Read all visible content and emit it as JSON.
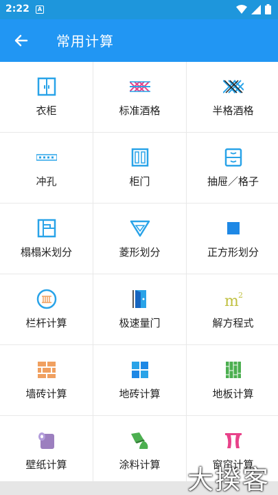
{
  "status_bar": {
    "time": "2:22",
    "notif_glyph": "A"
  },
  "app_bar": {
    "title": "常用计算",
    "back_icon": "arrow-left-icon"
  },
  "colors": {
    "accent": "#2196f3",
    "status": "#1e96dc",
    "blue_icon": "#29a3e8",
    "pink": "#e8428a",
    "green": "#4caf50",
    "orange": "#f0a060",
    "olive": "#c0c040",
    "purple": "#9c7fbf"
  },
  "items": [
    {
      "label": "衣柜",
      "icon": "wardrobe-icon"
    },
    {
      "label": "标准酒格",
      "icon": "standard-wine-rack-icon"
    },
    {
      "label": "半格酒格",
      "icon": "half-wine-rack-icon"
    },
    {
      "label": "冲孔",
      "icon": "punch-hole-icon"
    },
    {
      "label": "柜门",
      "icon": "cabinet-door-icon"
    },
    {
      "label": "抽屉／格子",
      "icon": "drawer-icon"
    },
    {
      "label": "榻榻米划分",
      "icon": "tatami-icon"
    },
    {
      "label": "菱形划分",
      "icon": "diamond-icon"
    },
    {
      "label": "正方形划分",
      "icon": "square-icon"
    },
    {
      "label": "栏杆计算",
      "icon": "railing-icon"
    },
    {
      "label": "极速量门",
      "icon": "door-measure-icon"
    },
    {
      "label": "解方程式",
      "icon": "equation-icon"
    },
    {
      "label": "墙砖计算",
      "icon": "wall-brick-icon"
    },
    {
      "label": "地砖计算",
      "icon": "floor-tile-icon"
    },
    {
      "label": "地板计算",
      "icon": "floor-board-icon"
    },
    {
      "label": "壁纸计算",
      "icon": "wallpaper-icon"
    },
    {
      "label": "涂料计算",
      "icon": "paint-icon"
    },
    {
      "label": "窗帘计算",
      "icon": "curtain-icon"
    }
  ],
  "watermark": "大揆客"
}
